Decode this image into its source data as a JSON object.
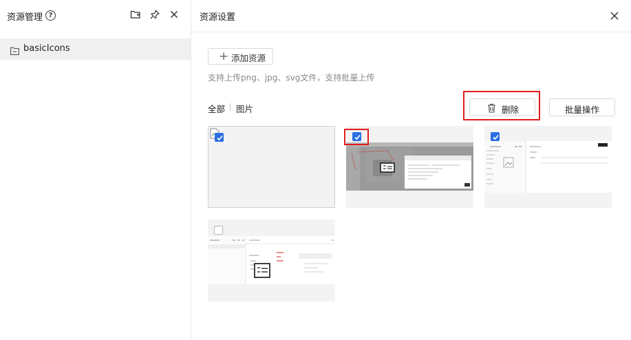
{
  "sidebar": {
    "title": "资源管理",
    "help_icon_glyph": "?",
    "tree": [
      {
        "label": "basicIcons",
        "icon": "folder-icon"
      }
    ]
  },
  "panel": {
    "title": "资源设置",
    "add_button_label": "添加资源",
    "hint": "支持上传png、jpg、svg文件，支持批量上传",
    "tabs": [
      {
        "label": "全部",
        "active": true
      },
      {
        "label": "图片",
        "active": false
      }
    ],
    "delete_label": "删除",
    "batch_label": "批量操作"
  },
  "assets": [
    {
      "kind": "broken-image",
      "checked": true
    },
    {
      "kind": "screenshot-dialog",
      "checked": true
    },
    {
      "kind": "screenshot-form",
      "checked": true
    },
    {
      "kind": "screenshot-workspace",
      "checked": false
    }
  ],
  "colors": {
    "accent": "#2b6fe0",
    "highlight": "#e01b1b",
    "selected_row": "#f0f0f0"
  }
}
